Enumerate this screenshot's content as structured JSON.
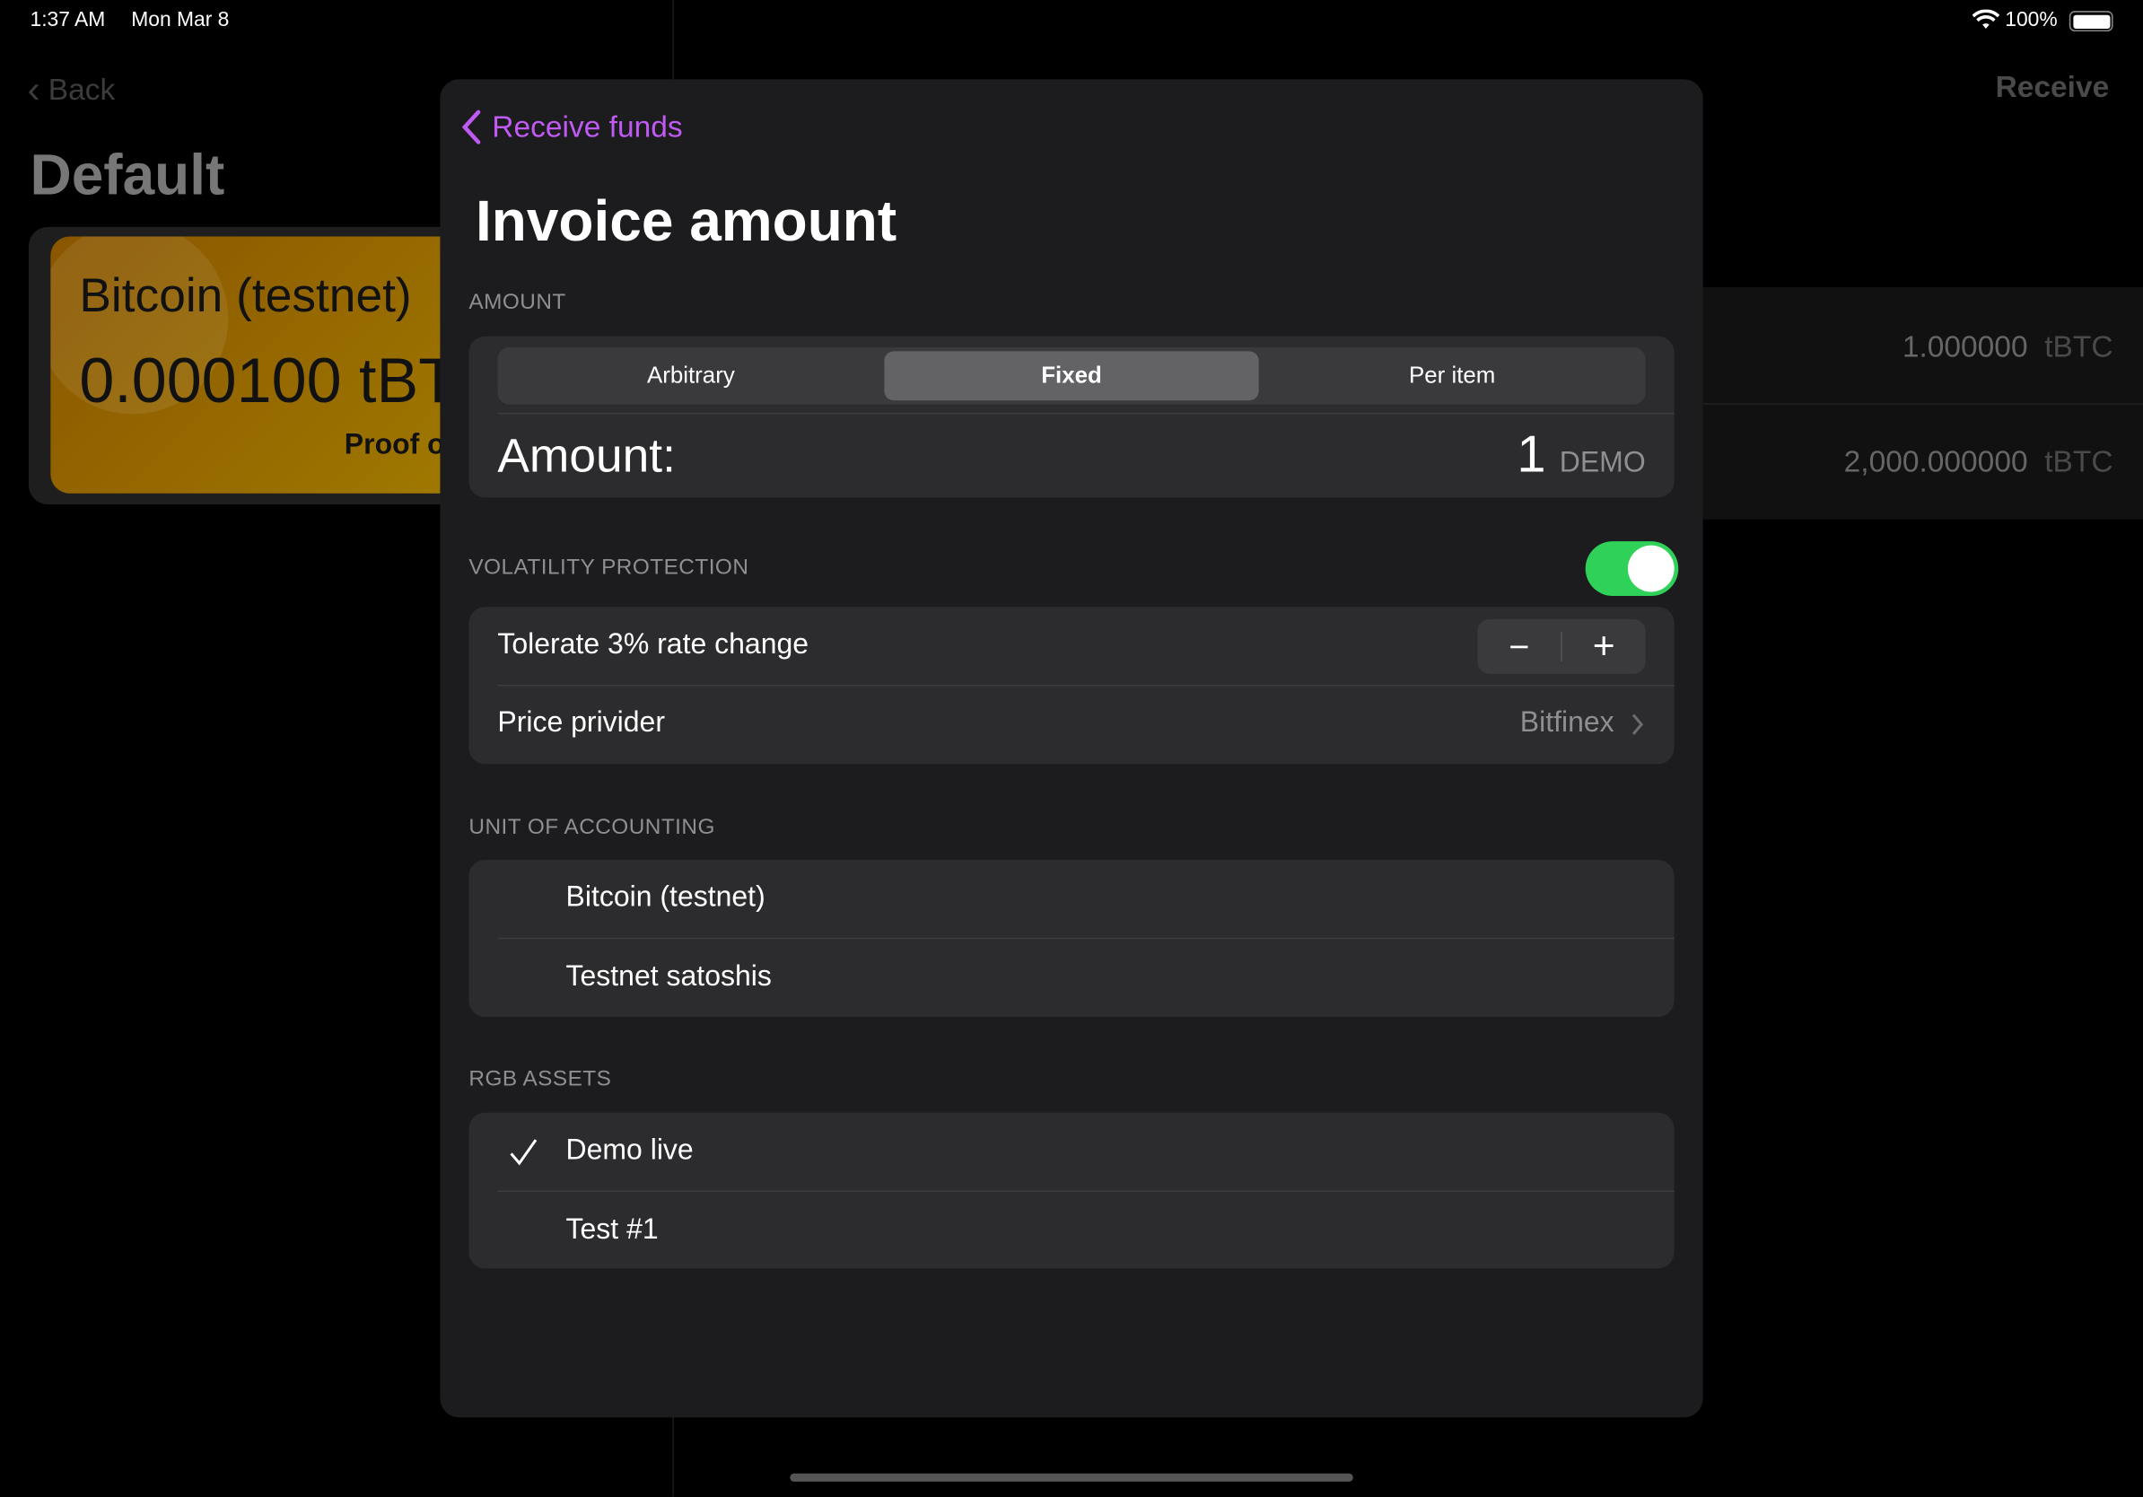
{
  "status_bar": {
    "time": "1:37 AM",
    "date": "Mon Mar 8",
    "battery": "100%",
    "battery_level": 1.0
  },
  "background": {
    "back_label": "Back",
    "title": "Default",
    "card": {
      "name": "Bitcoin (testnet)",
      "balance": "0.000100 tBT",
      "footer": "Proof o"
    },
    "receive_label": "Receive",
    "rows": [
      {
        "amount": "1.000000",
        "unit": "tBTC"
      },
      {
        "amount": "2,000.000000",
        "unit": "tBTC"
      }
    ]
  },
  "modal": {
    "back_label": "Receive funds",
    "title": "Invoice amount",
    "accent_color": "#bf5af2",
    "amount_section": {
      "header": "AMOUNT",
      "segments": [
        "Arbitrary",
        "Fixed",
        "Per item"
      ],
      "selected_segment": "Fixed",
      "amount_label": "Amount:",
      "amount_value": "1",
      "amount_unit": "DEMO"
    },
    "volatility_section": {
      "header": "VOLATILITY PROTECTION",
      "toggle_on": true,
      "toggle_color": "#30d158",
      "tolerance_label": "Tolerate 3% rate change",
      "stepper_minus": "−",
      "stepper_plus": "+",
      "price_provider_label": "Price privider",
      "price_provider_value": "Bitfinex"
    },
    "unit_section": {
      "header": "UNIT OF ACCOUNTING",
      "items": [
        "Bitcoin (testnet)",
        "Testnet satoshis"
      ]
    },
    "rgb_section": {
      "header": "RGB ASSETS",
      "items": [
        {
          "label": "Demo live",
          "checked": true
        },
        {
          "label": "Test #1",
          "checked": false
        }
      ]
    }
  }
}
